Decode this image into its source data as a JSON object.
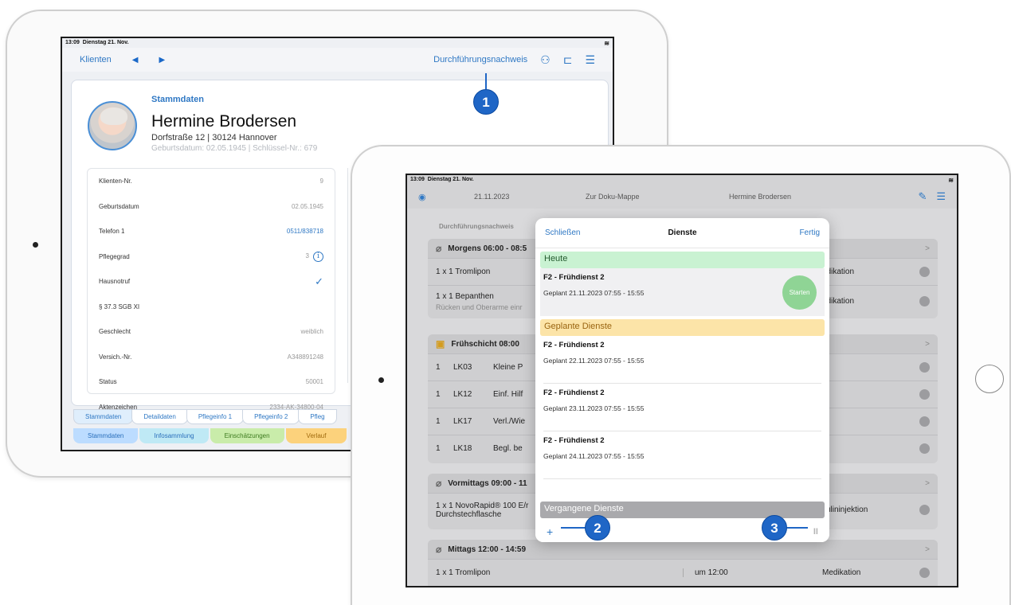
{
  "device1": {
    "status": {
      "time": "13:09",
      "date": "Dienstag 21. Nov."
    },
    "nav": {
      "back_label": "Klienten",
      "prev": "◀",
      "next": "▶",
      "link": "Durchführungsnachweis"
    },
    "card": {
      "section": "Stammdaten",
      "name": "Hermine Brodersen",
      "address": "Dorfstraße 12 | 30124 Hannover",
      "meta": "Geburtsdatum: 02.05.1945 | Schlüssel-Nr.: 679",
      "rows": [
        {
          "label": "Klienten-Nr.",
          "value": "9"
        },
        {
          "label": "Geburtsdatum",
          "value": "02.05.1945"
        },
        {
          "label": "Telefon 1",
          "value": "0511/838718"
        },
        {
          "label": "Pflegegrad",
          "value": "3"
        },
        {
          "label": "Hausnotruf",
          "value": "✓"
        },
        {
          "label": "§ 37.3 SGB XI",
          "value": ""
        },
        {
          "label": "Geschlecht",
          "value": "weiblich"
        },
        {
          "label": "Versich.-Nr.",
          "value": "A348891248"
        },
        {
          "label": "Status",
          "value": "50001"
        },
        {
          "label": "Aktenzeichen",
          "value": "2334-AK-34800-04"
        }
      ]
    },
    "tabs_top": [
      "Stammdaten",
      "Detaildaten",
      "Pflegeinfo 1",
      "Pflegeinfo 2",
      "Pfleg"
    ],
    "tabs_bottom": [
      {
        "label": "Stammdaten",
        "color": "#bcdcff"
      },
      {
        "label": "Infosammlung",
        "color": "#bfe9f5"
      },
      {
        "label": "Einschätzungen",
        "color": "#c9ecaa"
      },
      {
        "label": "Verlauf",
        "color": "#fcd27c"
      }
    ]
  },
  "device2": {
    "status": {
      "time": "13:09",
      "date": "Dienstag 21. Nov."
    },
    "nav": {
      "date": "21.11.2023",
      "doku": "Zur Doku-Mappe",
      "client": "Hermine Brodersen"
    },
    "bg_title": "Durchführungsnachweis",
    "sections": [
      {
        "title": "Morgens 06:00 - 08:5",
        "rows": [
          {
            "left": "1 x 1 Tromlipon",
            "right": "edikation"
          },
          {
            "left": "1 x 1 Bepanthen",
            "sub": "Rücken und Oberarme einr",
            "right": "edikation"
          }
        ]
      },
      {
        "title": "Frühschicht 08:00",
        "rows": [
          {
            "n": "1",
            "lk": "LK03",
            "txt": "Kleine P"
          },
          {
            "n": "1",
            "lk": "LK12",
            "txt": "Einf. Hilf"
          },
          {
            "n": "1",
            "lk": "LK17",
            "txt": "Verl./Wie"
          },
          {
            "n": "1",
            "lk": "LK18",
            "txt": "Begl. be"
          }
        ]
      },
      {
        "title": "Vormittags 09:00 - 11",
        "rows": [
          {
            "left": "1 x 1 NovoRapid® 100 E/r",
            "sub": "Durchstechflasche",
            "right": "sulininjektion"
          }
        ]
      },
      {
        "title": "Mittags 12:00 - 14:59",
        "rows": [
          {
            "left": "1 x 1 Tromlipon",
            "mid": "um 12:00",
            "right": "Medikation"
          }
        ]
      }
    ],
    "modal": {
      "close": "Schließen",
      "title": "Dienste",
      "done": "Fertig",
      "today_label": "Heute",
      "today": {
        "name": "F2 - Frühdienst 2",
        "planned": "Geplant 21.11.2023 07:55 - 15:55",
        "start": "Starten"
      },
      "planned_label": "Geplante Dienste",
      "planned": [
        {
          "name": "F2 - Frühdienst 2",
          "planned": "Geplant 22.11.2023 07:55 - 15:55"
        },
        {
          "name": "F2 - Frühdienst 2",
          "planned": "Geplant 23.11.2023 07:55 - 15:55"
        },
        {
          "name": "F2 - Frühdienst 2",
          "planned": "Geplant 24.11.2023 07:55 - 15:55"
        }
      ],
      "past_label": "Vergangene Dienste",
      "add": "+",
      "pause": "II"
    }
  },
  "callouts": [
    "1",
    "2",
    "3"
  ]
}
